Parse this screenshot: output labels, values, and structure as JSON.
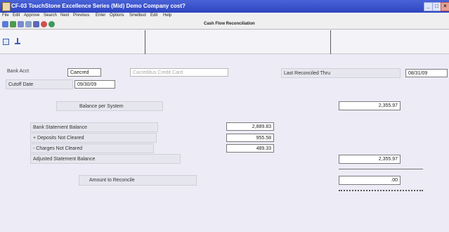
{
  "window": {
    "title": "CF-03   TouchStone Excellence Series (Mid)    Demo Company cost?",
    "minimize_glyph": "_",
    "maximize_glyph": "□",
    "close_glyph": "×"
  },
  "menu": [
    "File",
    "Edit",
    "Approve",
    "Search",
    "Next",
    "Previous",
    "Enter",
    "Options",
    "Smelbud",
    "Edit",
    "Help"
  ],
  "form_title": "Cash Flow Reconciliation",
  "toolbar_icons": [
    "save-icon",
    "print-icon",
    "copy-icon",
    "find-icon",
    "chart-icon",
    "help-icon",
    "exit-icon"
  ],
  "colors": {
    "titlebar": "#3a52cc",
    "panel": "#ecebf6"
  },
  "fields": {
    "bank_acct_label": "Bank Acct",
    "bank_acct_value": "Caecred",
    "bank_acct_desc": "Cacreditus Credit Card",
    "cutoff_label": "Cutoff Date",
    "cutoff_value": "09/30/09",
    "last_reconciled_label": "Last Reconciled Thru",
    "last_reconciled_value": "08/31/09"
  },
  "summary": {
    "balance_per_system_label": "Balance per System",
    "balance_per_system_value": "2,355.97",
    "bank_statement_label": "Bank Statement Balance",
    "bank_statement_value": "2,889.83",
    "deposits_label": "+ Deposits Not Cleared",
    "deposits_value": "955.58",
    "charges_label": "- Charges Not Cleared",
    "charges_value": "489.33",
    "adjusted_label": "Adjusted Statement Balance",
    "adjusted_value": "2,355.97",
    "to_reconcile_label": "Amount to Reconcile",
    "to_reconcile_value": ".00"
  }
}
